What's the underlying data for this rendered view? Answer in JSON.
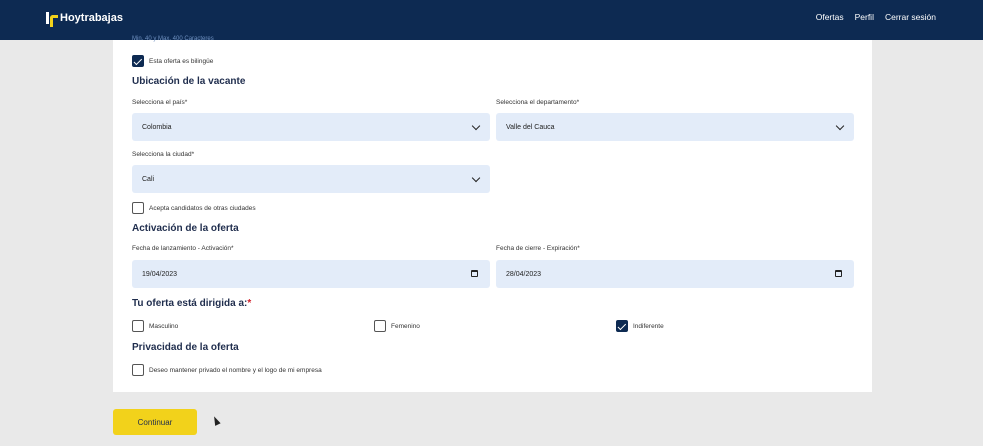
{
  "header": {
    "brand": "Hoytrabajas",
    "nav": [
      {
        "label": "Ofertas"
      },
      {
        "label": "Perfil"
      },
      {
        "label": "Cerrar sesión"
      }
    ]
  },
  "form": {
    "char_hint": "Min. 40 y Max. 400 Caracteres",
    "bilingual": {
      "label": "Esta oferta es bilingüe",
      "checked": true
    },
    "location": {
      "title": "Ubicación de la vacante",
      "country_label": "Selecciona el país*",
      "country_value": "Colombia",
      "department_label": "Selecciona el departamento*",
      "department_value": "Valle del Cauca",
      "city_label": "Selecciona la ciudad*",
      "city_value": "Cali",
      "other_cities": {
        "label": "Acepta candidatos de otras ciudades",
        "checked": false
      }
    },
    "activation": {
      "title": "Activación de la oferta",
      "launch_label": "Fecha de lanzamiento - Activación*",
      "launch_value": "19/04/2023",
      "expiry_label": "Fecha de cierre - Expiración*",
      "expiry_value": "28/04/2023"
    },
    "target": {
      "title": "Tu oferta está dirigida a:",
      "required_mark": "*",
      "options": [
        {
          "label": "Masculino",
          "checked": false
        },
        {
          "label": "Femenino",
          "checked": false
        },
        {
          "label": "Indiferente",
          "checked": true
        }
      ]
    },
    "privacy": {
      "title": "Privacidad de la oferta",
      "option": {
        "label": "Deseo mantener privado el nombre y el logo de mi empresa",
        "checked": false
      }
    },
    "continue_label": "Continuar"
  },
  "colors": {
    "header_bg": "#0d2a52",
    "accent_yellow": "#f2d21b",
    "field_bg": "#e3ecf9"
  }
}
